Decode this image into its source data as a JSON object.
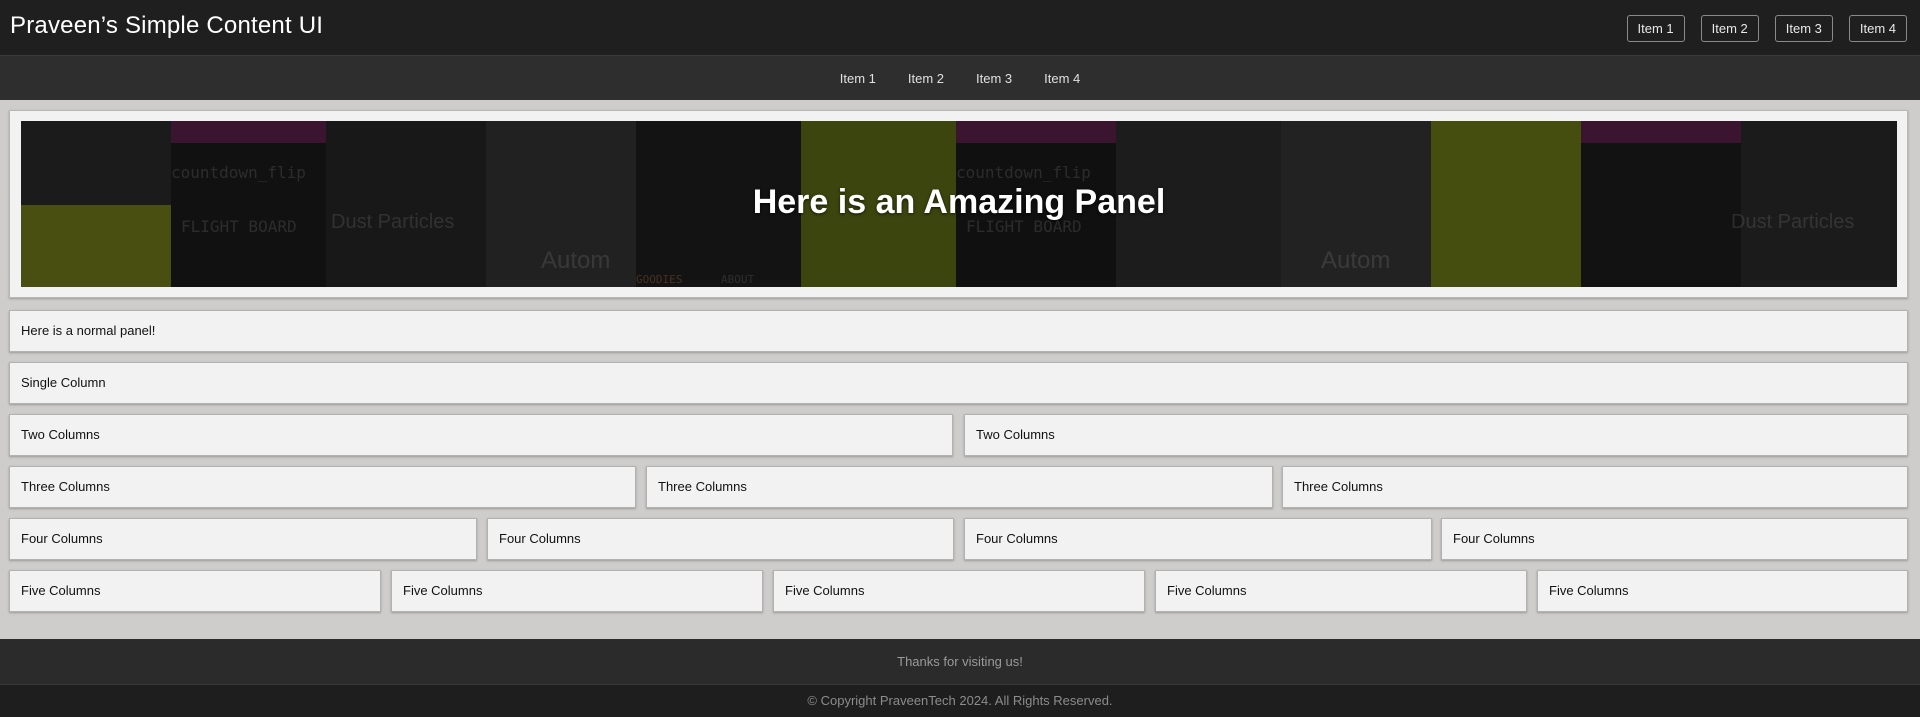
{
  "header": {
    "title": "Praveen’s Simple Content UI",
    "actions": [
      "Item 1",
      "Item 2",
      "Item 3",
      "Item 4"
    ]
  },
  "nav": {
    "items": [
      "Item 1",
      "Item 2",
      "Item 3",
      "Item 4"
    ]
  },
  "hero": {
    "title": "Here is an Amazing Panel",
    "background_labels": [
      "countdown_flip",
      "FLIGHT BOARD",
      "Dust Particles",
      "Autom",
      "GOODIES",
      "ABOUT",
      "countdown_flip",
      "FLIGHT BOARD",
      "Dust Particles",
      "Autom"
    ]
  },
  "panels": {
    "normal": "Here is a normal panel!",
    "single": [
      "Single Column"
    ],
    "two": [
      "Two Columns",
      "Two Columns"
    ],
    "three": [
      "Three Columns",
      "Three Columns",
      "Three Columns"
    ],
    "four": [
      "Four Columns",
      "Four Columns",
      "Four Columns",
      "Four Columns"
    ],
    "five": [
      "Five Columns",
      "Five Columns",
      "Five Columns",
      "Five Columns",
      "Five Columns"
    ]
  },
  "footer": {
    "message": "Thanks for visiting us!",
    "copyright": "© Copyright PraveenTech 2024. All Rights Reserved."
  },
  "colors": {
    "header_bg": "#1f1f1f",
    "nav_bg": "#2e2e2e",
    "page_bg": "#cfcdcb",
    "panel_bg": "#f2f2f2"
  }
}
